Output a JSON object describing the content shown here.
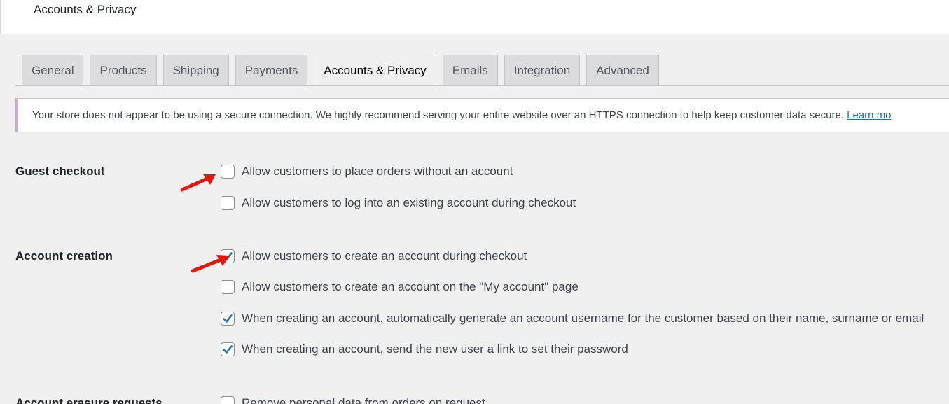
{
  "header": {
    "title": "Accounts & Privacy"
  },
  "tabs": [
    {
      "label": "General",
      "active": false
    },
    {
      "label": "Products",
      "active": false
    },
    {
      "label": "Shipping",
      "active": false
    },
    {
      "label": "Payments",
      "active": false
    },
    {
      "label": "Accounts & Privacy",
      "active": true
    },
    {
      "label": "Emails",
      "active": false
    },
    {
      "label": "Integration",
      "active": false
    },
    {
      "label": "Advanced",
      "active": false
    }
  ],
  "notice": {
    "text": "Your store does not appear to be using a secure connection. We highly recommend serving your entire website over an HTTPS connection to help keep customer data secure.",
    "link": "Learn mo"
  },
  "guest_checkout": {
    "label": "Guest checkout",
    "options": [
      {
        "label": "Allow customers to place orders without an account",
        "checked": false
      },
      {
        "label": "Allow customers to log into an existing account during checkout",
        "checked": false
      }
    ]
  },
  "account_creation": {
    "label": "Account creation",
    "options": [
      {
        "label": "Allow customers to create an account during checkout",
        "checked": true
      },
      {
        "label": "Allow customers to create an account on the \"My account\" page",
        "checked": false
      },
      {
        "label": "When creating an account, automatically generate an account username for the customer based on their name, surname or email",
        "checked": true
      },
      {
        "label": "When creating an account, send the new user a link to set their password",
        "checked": true
      }
    ]
  },
  "account_erasure": {
    "label": "Account erasure requests",
    "options": [
      {
        "label": "Remove personal data from orders on request",
        "checked": false
      }
    ]
  },
  "colors": {
    "checkmark": "#2271b1",
    "arrow": "#e3170a",
    "notice_border": "#c9b0c7",
    "link": "#2271b1"
  },
  "icons": {
    "checkmark": "checkmark-icon",
    "annotation": "red-arrow-icon"
  }
}
